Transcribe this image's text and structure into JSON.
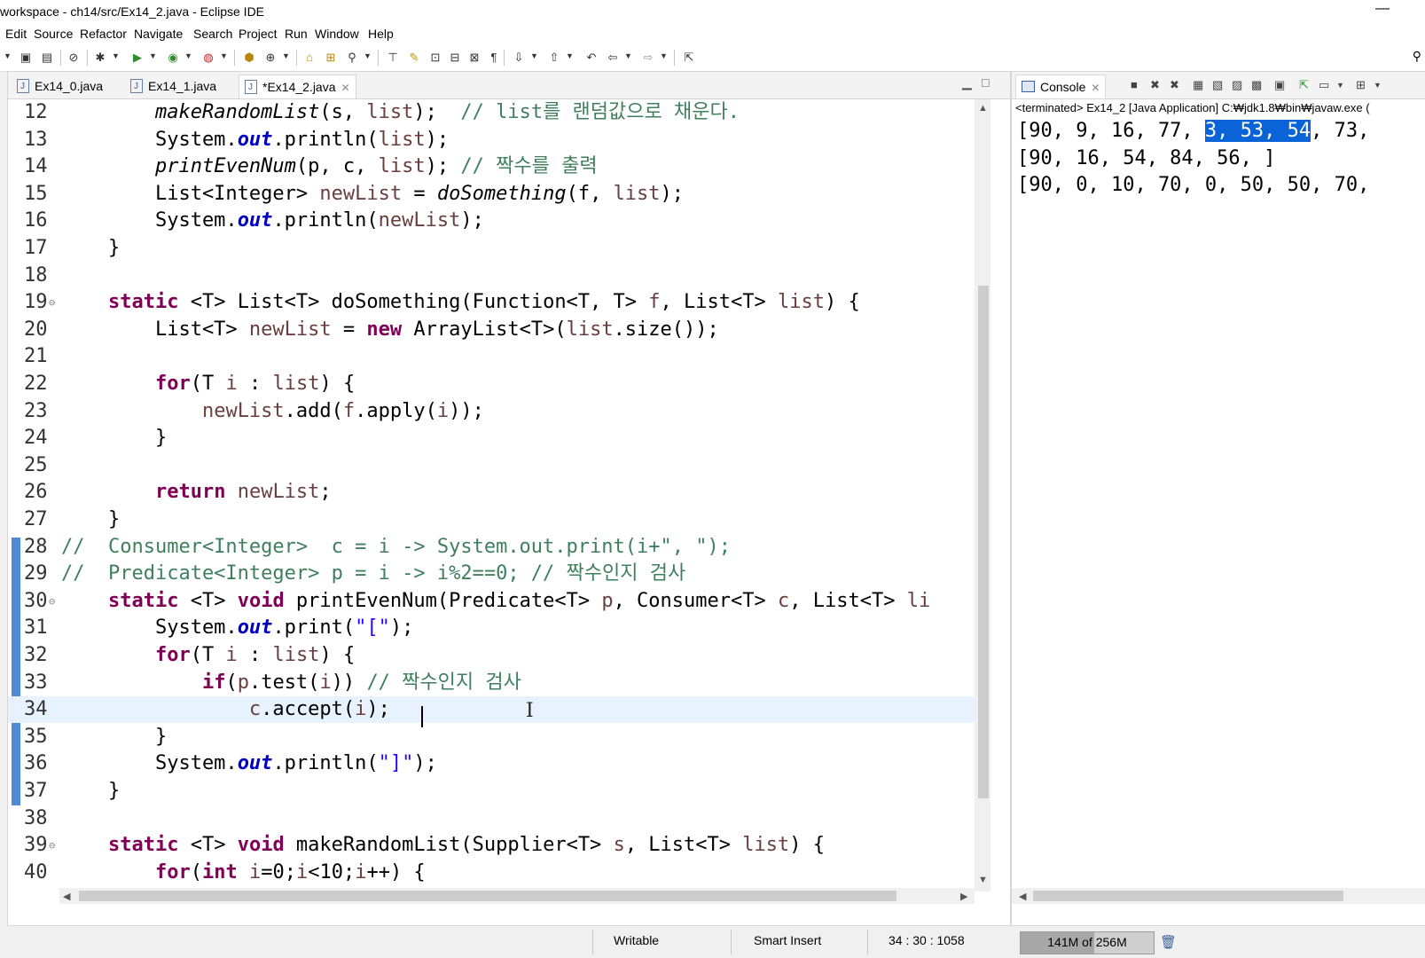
{
  "window": {
    "title": "workspace - ch14/src/Ex14_2.java - Eclipse IDE",
    "minimize_glyph": "—"
  },
  "menu": [
    "Edit",
    "Source",
    "Refactor",
    "Navigate",
    "Search",
    "Project",
    "Run",
    "Window",
    "Help"
  ],
  "editor": {
    "tabs": [
      {
        "label": "Ex14_0.java",
        "active": false
      },
      {
        "label": "Ex14_1.java",
        "active": false
      },
      {
        "label": "*Ex14_2.java",
        "active": true
      }
    ],
    "lines": [
      {
        "n": "12",
        "tokens": [
          [
            "",
            "        "
          ],
          [
            "sm",
            "makeRandomList"
          ],
          [
            "",
            "(s, "
          ],
          [
            "fl",
            "list"
          ],
          [
            "",
            ");  "
          ],
          [
            "cm",
            "// list를 랜덤값으로 채운다."
          ]
        ]
      },
      {
        "n": "13",
        "tokens": [
          [
            "",
            "        System."
          ],
          [
            "sf",
            "out"
          ],
          [
            "",
            ".println("
          ],
          [
            "fl",
            "list"
          ],
          [
            "",
            ");"
          ]
        ]
      },
      {
        "n": "14",
        "tokens": [
          [
            "",
            "        "
          ],
          [
            "sm",
            "printEvenNum"
          ],
          [
            "",
            "(p, c, "
          ],
          [
            "fl",
            "list"
          ],
          [
            "",
            "); "
          ],
          [
            "cm",
            "// 짝수를 출력"
          ]
        ]
      },
      {
        "n": "15",
        "tokens": [
          [
            "",
            "        List<Integer> "
          ],
          [
            "fl",
            "newList"
          ],
          [
            "",
            " = "
          ],
          [
            "sm",
            "doSomething"
          ],
          [
            "",
            "(f, "
          ],
          [
            "fl",
            "list"
          ],
          [
            "",
            ");"
          ]
        ]
      },
      {
        "n": "16",
        "tokens": [
          [
            "",
            "        System."
          ],
          [
            "sf",
            "out"
          ],
          [
            "",
            ".println("
          ],
          [
            "fl",
            "newList"
          ],
          [
            "",
            ");"
          ]
        ]
      },
      {
        "n": "17",
        "tokens": [
          [
            "",
            "    }"
          ]
        ]
      },
      {
        "n": "18",
        "tokens": []
      },
      {
        "n": "19",
        "fold": true,
        "tokens": [
          [
            "",
            "    "
          ],
          [
            "kw",
            "static"
          ],
          [
            "",
            " <T> List<T> doSomething(Function<T, T> "
          ],
          [
            "fl",
            "f"
          ],
          [
            "",
            ", List<T> "
          ],
          [
            "fl",
            "list"
          ],
          [
            "",
            ") {"
          ]
        ]
      },
      {
        "n": "20",
        "tokens": [
          [
            "",
            "        List<T> "
          ],
          [
            "fl",
            "newList"
          ],
          [
            "",
            " = "
          ],
          [
            "kw",
            "new"
          ],
          [
            "",
            " ArrayList<T>("
          ],
          [
            "fl",
            "list"
          ],
          [
            "",
            ".size());"
          ]
        ]
      },
      {
        "n": "21",
        "tokens": []
      },
      {
        "n": "22",
        "tokens": [
          [
            "",
            "        "
          ],
          [
            "kw",
            "for"
          ],
          [
            "",
            "(T "
          ],
          [
            "fl",
            "i"
          ],
          [
            "",
            " : "
          ],
          [
            "fl",
            "list"
          ],
          [
            "",
            ") {"
          ]
        ]
      },
      {
        "n": "23",
        "tokens": [
          [
            "",
            "            "
          ],
          [
            "fl",
            "newList"
          ],
          [
            "",
            ".add("
          ],
          [
            "fl",
            "f"
          ],
          [
            "",
            ".apply("
          ],
          [
            "fl",
            "i"
          ],
          [
            "",
            "));"
          ]
        ]
      },
      {
        "n": "24",
        "tokens": [
          [
            "",
            "        }"
          ]
        ]
      },
      {
        "n": "25",
        "tokens": []
      },
      {
        "n": "26",
        "tokens": [
          [
            "",
            "        "
          ],
          [
            "kw",
            "return"
          ],
          [
            "",
            " "
          ],
          [
            "fl",
            "newList"
          ],
          [
            "",
            ";"
          ]
        ]
      },
      {
        "n": "27",
        "tokens": [
          [
            "",
            "    }"
          ]
        ]
      },
      {
        "n": "28",
        "tokens": [
          [
            "cm",
            "//  Consumer<Integer>  c = i -> System.out.print(i+\", \");"
          ]
        ]
      },
      {
        "n": "29",
        "tokens": [
          [
            "cm",
            "//  Predicate<Integer> p = i -> i%2==0; // 짝수인지 검사"
          ]
        ]
      },
      {
        "n": "30",
        "fold": true,
        "tokens": [
          [
            "",
            "    "
          ],
          [
            "kw",
            "static"
          ],
          [
            "",
            " <T> "
          ],
          [
            "kw",
            "void"
          ],
          [
            "",
            " printEvenNum(Predicate<T> "
          ],
          [
            "fl",
            "p"
          ],
          [
            "",
            ", Consumer<T> "
          ],
          [
            "fl",
            "c"
          ],
          [
            "",
            ", List<T> "
          ],
          [
            "fl",
            "li"
          ]
        ]
      },
      {
        "n": "31",
        "tokens": [
          [
            "",
            "        System."
          ],
          [
            "sf",
            "out"
          ],
          [
            "",
            ".print("
          ],
          [
            "st",
            "\"[\""
          ],
          [
            "",
            ");"
          ]
        ]
      },
      {
        "n": "32",
        "tokens": [
          [
            "",
            "        "
          ],
          [
            "kw",
            "for"
          ],
          [
            "",
            "(T "
          ],
          [
            "fl",
            "i"
          ],
          [
            "",
            " : "
          ],
          [
            "fl",
            "list"
          ],
          [
            "",
            ") {"
          ]
        ]
      },
      {
        "n": "33",
        "tokens": [
          [
            "",
            "            "
          ],
          [
            "kw",
            "if"
          ],
          [
            "",
            "("
          ],
          [
            "fl",
            "p"
          ],
          [
            "",
            ".test("
          ],
          [
            "fl",
            "i"
          ],
          [
            "",
            ")) "
          ],
          [
            "cm",
            "// 짝수인지 검사"
          ]
        ]
      },
      {
        "n": "34",
        "current": true,
        "tokens": [
          [
            "",
            "                "
          ],
          [
            "fl",
            "c"
          ],
          [
            "",
            ".accept("
          ],
          [
            "fl",
            "i"
          ],
          [
            "",
            "); "
          ]
        ]
      },
      {
        "n": "35",
        "tokens": [
          [
            "",
            "        }"
          ]
        ]
      },
      {
        "n": "36",
        "tokens": [
          [
            "",
            "        System."
          ],
          [
            "sf",
            "out"
          ],
          [
            "",
            ".println("
          ],
          [
            "st",
            "\"]\""
          ],
          [
            "",
            ");"
          ]
        ]
      },
      {
        "n": "37",
        "tokens": [
          [
            "",
            "    }"
          ]
        ]
      },
      {
        "n": "38",
        "tokens": []
      },
      {
        "n": "39",
        "fold": true,
        "tokens": [
          [
            "",
            "    "
          ],
          [
            "kw",
            "static"
          ],
          [
            "",
            " <T> "
          ],
          [
            "kw",
            "void"
          ],
          [
            "",
            " makeRandomList(Supplier<T> "
          ],
          [
            "fl",
            "s"
          ],
          [
            "",
            ", List<T> "
          ],
          [
            "fl",
            "list"
          ],
          [
            "",
            ") {"
          ]
        ]
      },
      {
        "n": "40",
        "tokens": [
          [
            "",
            "        "
          ],
          [
            "kw",
            "for"
          ],
          [
            "",
            "("
          ],
          [
            "kw",
            "int"
          ],
          [
            "",
            " "
          ],
          [
            "fl",
            "i"
          ],
          [
            "",
            "=0;"
          ],
          [
            "fl",
            "i"
          ],
          [
            "",
            "<10;"
          ],
          [
            "fl",
            "i"
          ],
          [
            "",
            "++) {"
          ]
        ]
      }
    ]
  },
  "console": {
    "tab_label": "Console",
    "status": "<terminated> Ex14_2 [Java Application] C:₩jdk1.8₩bin₩javaw.exe (",
    "lines": [
      {
        "before": "[90, 9, 16, 77, ",
        "selected": "3, 53, 54",
        "after": ", 73,"
      },
      {
        "before": "[90, 16, 54, 84, 56, ]",
        "selected": "",
        "after": ""
      },
      {
        "before": "[90, 0, 10, 70, 0, 50, 50, 70,",
        "selected": "",
        "after": ""
      }
    ]
  },
  "status_bar": {
    "write_mode": "Writable",
    "insert_mode": "Smart Insert",
    "position": "34 : 30 : 1058",
    "heap": "141M of 256M",
    "heap_used_fraction": 0.55
  },
  "colors": {
    "keyword": "#7f0055",
    "comment": "#3f7f5f",
    "field": "#0000c0",
    "string": "#2a00ff",
    "selection": "#0a64d7"
  }
}
